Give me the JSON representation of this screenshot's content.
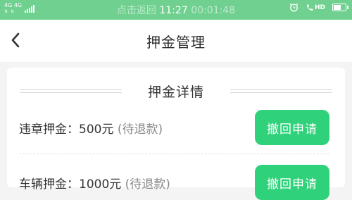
{
  "status_bar": {
    "network": "4G 4G",
    "network_arrows": "⇅ ⇅",
    "hint": "点击返回",
    "time": "11:27",
    "timer": "00:01:48",
    "hd": "HD",
    "battery_level": 0.6
  },
  "nav": {
    "title": "押金管理"
  },
  "section": {
    "title": "押金详情"
  },
  "deposits": [
    {
      "label": "违章押金：",
      "amount": "500元",
      "status": "(待退款)",
      "action": "撤回申请"
    },
    {
      "label": "车辆押金：",
      "amount": "1000元",
      "status": "(待退款)",
      "action": "撤回申请"
    }
  ],
  "colors": {
    "status_bar": "#6fd08f",
    "accent": "#2fd27a",
    "background": "#f4f4f4"
  }
}
